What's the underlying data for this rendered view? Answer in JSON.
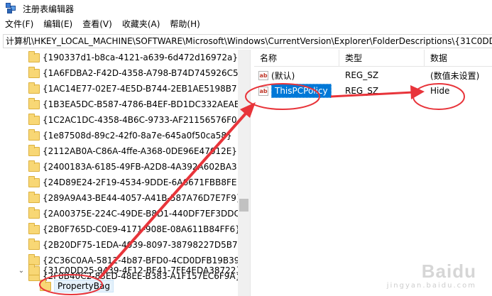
{
  "window": {
    "title": "注册表编辑器"
  },
  "menu": [
    "文件(F)",
    "编辑(E)",
    "查看(V)",
    "收藏夹(A)",
    "帮助(H)"
  ],
  "address": "计算机\\HKEY_LOCAL_MACHINE\\SOFTWARE\\Microsoft\\Windows\\CurrentVersion\\Explorer\\FolderDescriptions\\{31C0DD",
  "tree": {
    "items": [
      "{190337d1-b8ca-4121-a639-6d472d16972a}",
      "{1A6FDBA2-F42D-4358-A798-B74D745926C5}",
      "{1AC14E77-02E7-4E5D-B744-2EB1AE5198B7}",
      "{1B3EA5DC-B587-4786-B4EF-BD1DC332AEAE}",
      "{1C2AC1DC-4358-4B6C-9733-AF21156576F0}",
      "{1e87508d-89c2-42f0-8a7e-645a0f50ca58}",
      "{2112AB0A-C86A-4ffe-A368-0DE96E47012E}",
      "{2400183A-6185-49FB-A2D8-4A392A602BA3}",
      "{24D89E24-2F19-4534-9DDE-6A6671FBB8FE}",
      "{289A9A43-BE44-4057-A41B-587A76D7E7F9}",
      "{2A00375E-224C-49DE-B8D1-440DF7EF3DDC}",
      "{2B0F765D-C0E9-4171-908E-08A611B84FF6}",
      "{2B20DF75-1EDA-4039-8097-38798227D5B7}",
      "{2C36C0AA-5812-4b87-BFD0-4CD0DFB19B39}",
      "{2F8B40C2-83ED-48EE-B383-A1F157EC6F9A}",
      "{31C0DD25-9439-4F12-BF41-7FF4EDA38722}"
    ],
    "expanded_child": "PropertyBag"
  },
  "values": {
    "headers": {
      "name": "名称",
      "type": "类型",
      "data": "数据"
    },
    "rows": [
      {
        "name": "(默认)",
        "type": "REG_SZ",
        "data": "(数值未设置)",
        "icon": "ab-string-icon"
      },
      {
        "name": "ThisPCPolicy",
        "type": "REG_SZ",
        "data": "Hide",
        "icon": "ab-string-icon"
      }
    ]
  },
  "colors": {
    "selection": "#0078d7",
    "annotation": "#e8343a",
    "folder": "#f8d775"
  },
  "watermark": {
    "text": "Baidu",
    "sub": "jingyan.baidu.com"
  }
}
